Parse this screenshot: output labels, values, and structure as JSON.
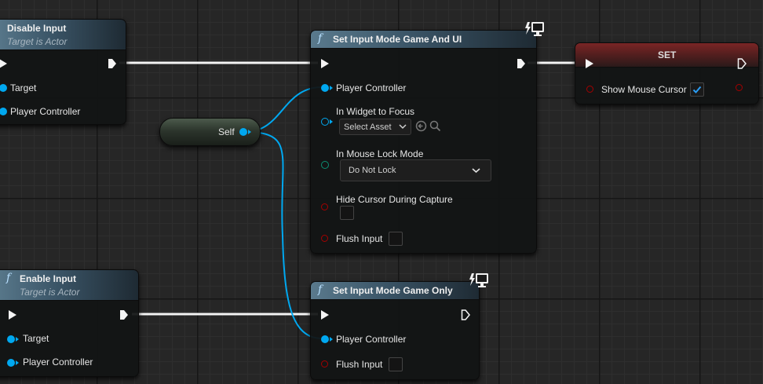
{
  "colors": {
    "object_pin": "#00a8f0",
    "bool_pin": "#a40000",
    "enum_pin": "#0c8e72",
    "exec": "#f4f4f4",
    "function_header": "#3a5466",
    "set_header": "#7a2525"
  },
  "icons": {
    "function": "f",
    "network": "authority-only-monitor-icon"
  },
  "nodes": {
    "disable_input": {
      "title": "Disable Input",
      "subtitle": "Target is Actor",
      "pins": [
        "Target",
        "Player Controller"
      ]
    },
    "enable_input": {
      "title": "Enable Input",
      "subtitle": "Target is Actor",
      "pins": [
        "Target",
        "Player Controller"
      ]
    },
    "self": {
      "label": "Self"
    },
    "set_input_mode_game_and_ui": {
      "title": "Set Input Mode Game And UI",
      "player_controller": "Player Controller",
      "widget_to_focus_label": "In Widget to Focus",
      "widget_to_focus_value": "Select Asset",
      "mouse_lock_label": "In Mouse Lock Mode",
      "mouse_lock_value": "Do Not Lock",
      "hide_cursor_label": "Hide Cursor During Capture",
      "hide_cursor_checked": false,
      "flush_input_label": "Flush Input",
      "flush_input_checked": false
    },
    "set_input_mode_game_only": {
      "title": "Set Input Mode Game Only",
      "player_controller": "Player Controller",
      "flush_input_label": "Flush Input",
      "flush_input_checked": false
    },
    "set_node": {
      "title": "SET",
      "variable_label": "Show Mouse Cursor",
      "variable_checked": true
    }
  }
}
